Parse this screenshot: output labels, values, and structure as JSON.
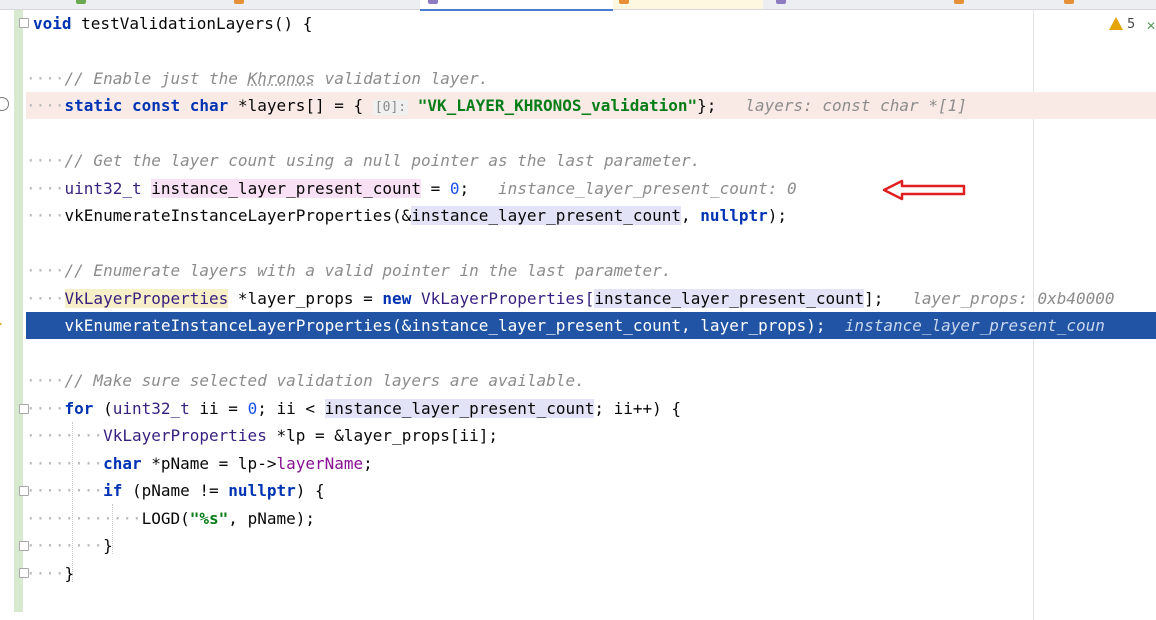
{
  "editor": {
    "warnings_count": "5",
    "lines": {
      "l1": {
        "kw": "void",
        "name": " testValidationLayers() {"
      },
      "l3": {
        "comment_a": "// Enable just the ",
        "comment_b": "Khronos",
        "comment_c": " validation layer."
      },
      "l4": {
        "kw1": "static",
        "kw2": "const",
        "kw3": "char",
        "rest": " *layers[] = { ",
        "hint": "[0]:",
        "str": "\"VK_LAYER_KHRONOS_validation\"",
        "close": "};",
        "inlay": "layers: const char *[1]"
      },
      "l6": {
        "comment": "// Get the layer count using a null pointer as the last parameter."
      },
      "l7": {
        "type": "uint32_t",
        "var": "instance_layer_present_count",
        "assign": " = ",
        "num": "0",
        "semi": ";",
        "inlay": "instance_layer_present_count: 0"
      },
      "l8": {
        "fn": "vkEnumerateInstanceLayerProperties(&",
        "var": "instance_layer_present_count",
        "sep": ", ",
        "kw": "nullptr",
        "close": ");"
      },
      "l10": {
        "comment": "// Enumerate layers with a valid pointer in the last parameter."
      },
      "l11": {
        "type": "VkLayerProperties",
        "mid": " *layer_props = ",
        "kw": "new",
        "type2": " VkLayerProperties[",
        "var": "instance_layer_present_count",
        "close": "];",
        "inlay": "layer_props: 0xb40000"
      },
      "l12": {
        "code": "vkEnumerateInstanceLayerProperties(&instance_layer_present_count, layer_props);",
        "inlay": "instance_layer_present_coun"
      },
      "l14": {
        "comment": "// Make sure selected validation layers are available."
      },
      "l15": {
        "kw": "for",
        "open": " (",
        "type": "uint32_t",
        "mid": " ii = ",
        "num": "0",
        "mid2": "; ii < ",
        "var": "instance_layer_present_count",
        "close": "; ii++) {"
      },
      "l16": {
        "type": "VkLayerProperties",
        "rest": " *lp = &layer_props[ii];"
      },
      "l17": {
        "kw": "char",
        "mid": " *pName = lp->",
        "field": "layerName",
        "close": ";"
      },
      "l18": {
        "kw": "if",
        "mid": " (pName != ",
        "kw2": "nullptr",
        "close": ") {"
      },
      "l19": {
        "fn": "LOGD(",
        "str": "\"%s\"",
        "close": ", pName);"
      },
      "l20": {
        "brace": "}"
      },
      "l21": {
        "brace": "}"
      }
    }
  },
  "colors": {
    "execution_line": "#2154a5",
    "breakpoint_line": "#faeae6",
    "arrow": "#e02020",
    "warning": "#e5a50a"
  },
  "icons": [
    "breakpoint-disabled-icon",
    "execution-point-icon",
    "intention-bulb-icon",
    "fold-icon",
    "warning-icon",
    "inspection-ok-icon",
    "red-arrow-annotation"
  ]
}
